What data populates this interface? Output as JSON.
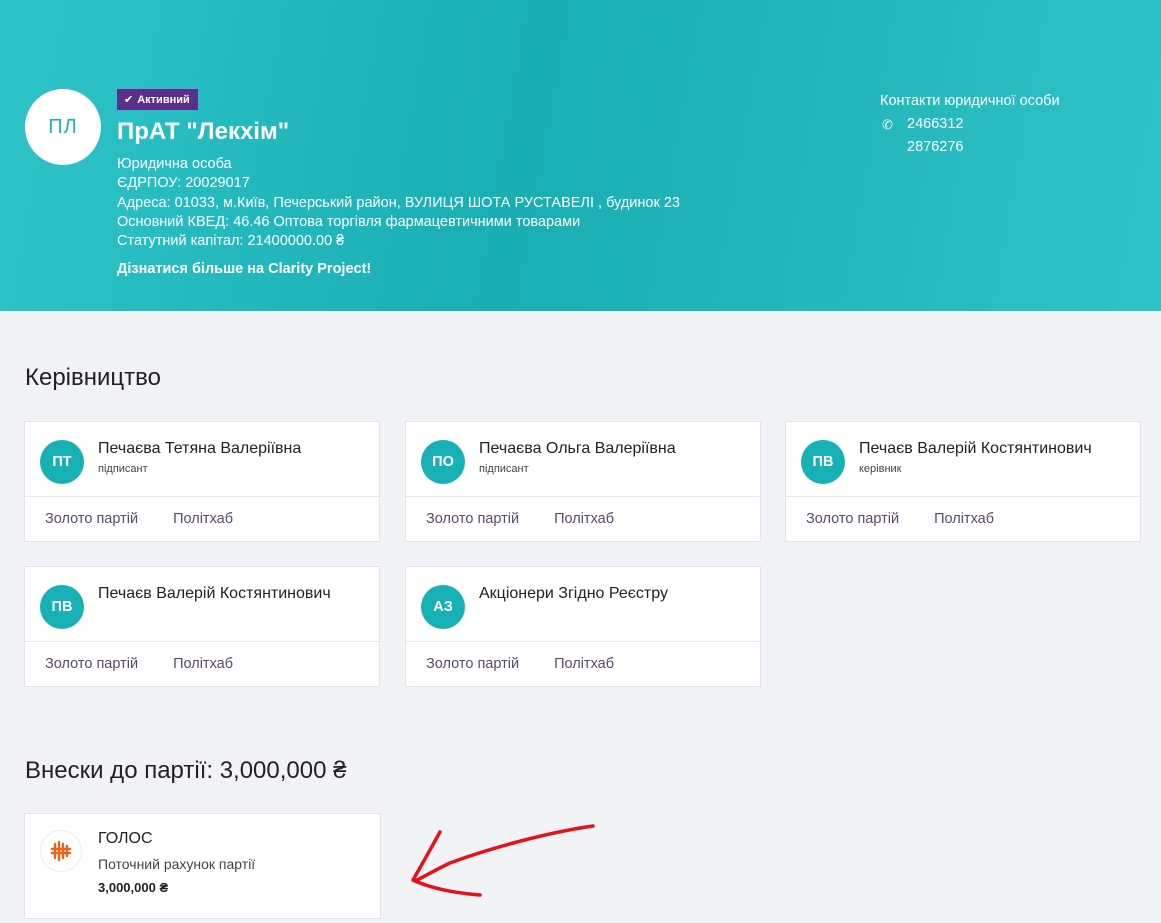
{
  "header": {
    "initials": "ПЛ",
    "status": "Активний",
    "name": "ПрАТ \"Лекхім\"",
    "type": "Юридична особа",
    "edrpou": "ЄДРПОУ: 20029017",
    "address": "Адреса: 01033, м.Київ, Печерський район, ВУЛИЦЯ ШОТА РУСТАВЕЛІ , будинок 23",
    "kved": "Основний КВЕД: 46.46 Оптова торгівля фармацевтичними товарами",
    "capital": "Статутний капітал: 21400000.00 ₴",
    "more_link": "Дізнатися більше на Clarity Project!",
    "contacts_title": "Контакти юридичної особи",
    "phones": [
      "2466312",
      "2876276"
    ]
  },
  "management": {
    "title": "Керівництво",
    "link_gold": "Золото партій",
    "link_politkhab": "Політхаб",
    "people": [
      {
        "initials": "ПТ",
        "name": "Печаєва Тетяна Валеріївна",
        "role": "підписант"
      },
      {
        "initials": "ПО",
        "name": "Печаєва Ольга Валеріївна",
        "role": "підписант"
      },
      {
        "initials": "ПВ",
        "name": "Печаєв Валерій Костянтинович",
        "role": "керівник"
      },
      {
        "initials": "ПВ",
        "name": "Печаєв Валерій Костянтинович",
        "role": ""
      },
      {
        "initials": "АЗ",
        "name": "Акціонери Згідно Реєстру",
        "role": ""
      }
    ]
  },
  "donations": {
    "title": "Внески до партії: 3,000,000 ₴",
    "items": [
      {
        "party": "ГОЛОС",
        "account": "Поточний рахунок партії",
        "amount": "3,000,000 ₴"
      }
    ]
  },
  "colors": {
    "accent": "#17b0b5",
    "badge": "#5b2e8c",
    "annotation_arrow": "#e0141b"
  }
}
